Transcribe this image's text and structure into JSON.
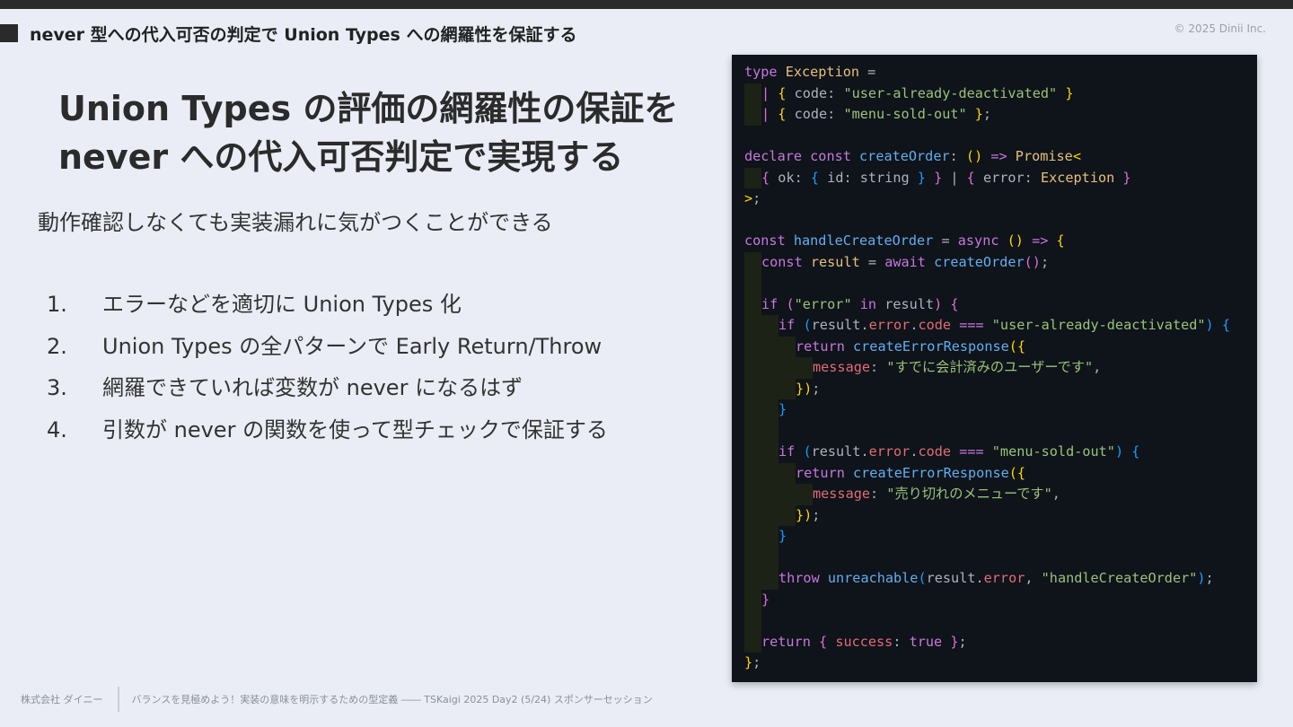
{
  "header": {
    "title": "never 型への代入可否の判定で Union Types への網羅性を保証する",
    "copyright": "© 2025 Dinii Inc."
  },
  "heading": {
    "line1": "Union Types の評価の網羅性の保証を",
    "line2": "never への代入可否判定で実現する"
  },
  "lead": "動作確認しなくても実装漏れに気がつくことができる",
  "steps": [
    {
      "num": "1.",
      "text": "エラーなどを適切に Union Types 化"
    },
    {
      "num": "2.",
      "text": "Union Types の全パターンで Early Return/Throw"
    },
    {
      "num": "3.",
      "text": "網羅できていれば変数が never になるはず"
    },
    {
      "num": "4.",
      "text": "引数が never の関数を使って型チェックで保証する"
    }
  ],
  "code": {
    "colors": {
      "keyword": "#c678dd",
      "type": "#e5c07b",
      "function": "#61afef",
      "string": "#98c379",
      "property": "#e06c75",
      "plain": "#abb2bf",
      "bracket1": "#ffd700",
      "bracket2": "#da70d6",
      "bracket3": "#179fff",
      "background": "#0f131a"
    },
    "lines": [
      {
        "indent": 0,
        "tokens": [
          [
            "kw",
            "type "
          ],
          [
            "type",
            "Exception "
          ],
          [
            "punc",
            "="
          ]
        ]
      },
      {
        "indent": 1,
        "tokens": [
          [
            "bl2",
            "| "
          ],
          [
            "bl",
            "{ "
          ],
          [
            "punc",
            "code: "
          ],
          [
            "str",
            "\"user-already-deactivated\""
          ],
          [
            "bl",
            " }"
          ]
        ]
      },
      {
        "indent": 1,
        "tokens": [
          [
            "bl2",
            "| "
          ],
          [
            "bl",
            "{ "
          ],
          [
            "punc",
            "code: "
          ],
          [
            "str",
            "\"menu-sold-out\""
          ],
          [
            "bl",
            " }"
          ],
          [
            "punc",
            ";"
          ]
        ]
      },
      {
        "indent": 0,
        "tokens": []
      },
      {
        "indent": 0,
        "tokens": [
          [
            "kw",
            "declare "
          ],
          [
            "kw",
            "const "
          ],
          [
            "fn",
            "createOrder"
          ],
          [
            "punc",
            ": "
          ],
          [
            "bl",
            "() "
          ],
          [
            "kw",
            "=> "
          ],
          [
            "type",
            "Promise"
          ],
          [
            "bl",
            "<"
          ]
        ]
      },
      {
        "indent": 1,
        "tokens": [
          [
            "bl2",
            "{ "
          ],
          [
            "punc",
            "ok: "
          ],
          [
            "bl3",
            "{ "
          ],
          [
            "punc",
            "id: string "
          ],
          [
            "bl3",
            "} "
          ],
          [
            "bl2",
            "} "
          ],
          [
            "punc",
            "| "
          ],
          [
            "bl2",
            "{ "
          ],
          [
            "punc",
            "error: "
          ],
          [
            "type",
            "Exception "
          ],
          [
            "bl2",
            "}"
          ]
        ]
      },
      {
        "indent": 0,
        "tokens": [
          [
            "bl",
            ">"
          ],
          [
            "punc",
            ";"
          ]
        ]
      },
      {
        "indent": 0,
        "tokens": []
      },
      {
        "indent": 0,
        "tokens": [
          [
            "kw",
            "const "
          ],
          [
            "fn",
            "handleCreateOrder "
          ],
          [
            "punc",
            "= "
          ],
          [
            "kw",
            "async "
          ],
          [
            "bl",
            "() "
          ],
          [
            "kw",
            "=> "
          ],
          [
            "bl",
            "{"
          ]
        ]
      },
      {
        "indent": 1,
        "tokens": [
          [
            "kw",
            "const "
          ],
          [
            "type",
            "result "
          ],
          [
            "punc",
            "= "
          ],
          [
            "kw",
            "await "
          ],
          [
            "fn",
            "createOrder"
          ],
          [
            "bl2",
            "()"
          ],
          [
            "punc",
            ";"
          ]
        ]
      },
      {
        "indent": 1,
        "tokens": []
      },
      {
        "indent": 1,
        "tokens": [
          [
            "kw",
            "if "
          ],
          [
            "bl2",
            "("
          ],
          [
            "str",
            "\"error\" "
          ],
          [
            "kw",
            "in "
          ],
          [
            "punc",
            "result"
          ],
          [
            "bl2",
            ") "
          ],
          [
            "bl2",
            "{"
          ]
        ]
      },
      {
        "indent": 2,
        "tokens": [
          [
            "kw",
            "if "
          ],
          [
            "bl3",
            "("
          ],
          [
            "punc",
            "result."
          ],
          [
            "prop",
            "error"
          ],
          [
            "punc",
            "."
          ],
          [
            "prop",
            "code "
          ],
          [
            "kw",
            "=== "
          ],
          [
            "str",
            "\"user-already-deactivated\""
          ],
          [
            "bl3",
            ") {"
          ]
        ]
      },
      {
        "indent": 3,
        "tokens": [
          [
            "kw",
            "return "
          ],
          [
            "fn",
            "createErrorResponse"
          ],
          [
            "bl",
            "({"
          ]
        ]
      },
      {
        "indent": 4,
        "tokens": [
          [
            "prop",
            "message"
          ],
          [
            "punc",
            ": "
          ],
          [
            "str",
            "\"すでに会計済みのユーザーです\""
          ],
          [
            "punc",
            ","
          ]
        ]
      },
      {
        "indent": 3,
        "tokens": [
          [
            "bl",
            "})"
          ],
          [
            "punc",
            ";"
          ]
        ]
      },
      {
        "indent": 2,
        "tokens": [
          [
            "bl3",
            "}"
          ]
        ]
      },
      {
        "indent": 2,
        "tokens": []
      },
      {
        "indent": 2,
        "tokens": [
          [
            "kw",
            "if "
          ],
          [
            "bl3",
            "("
          ],
          [
            "punc",
            "result."
          ],
          [
            "prop",
            "error"
          ],
          [
            "punc",
            "."
          ],
          [
            "prop",
            "code "
          ],
          [
            "kw",
            "=== "
          ],
          [
            "str",
            "\"menu-sold-out\""
          ],
          [
            "bl3",
            ") {"
          ]
        ]
      },
      {
        "indent": 3,
        "tokens": [
          [
            "kw",
            "return "
          ],
          [
            "fn",
            "createErrorResponse"
          ],
          [
            "bl",
            "({"
          ]
        ]
      },
      {
        "indent": 4,
        "tokens": [
          [
            "prop",
            "message"
          ],
          [
            "punc",
            ": "
          ],
          [
            "str",
            "\"売り切れのメニューです\""
          ],
          [
            "punc",
            ","
          ]
        ]
      },
      {
        "indent": 3,
        "tokens": [
          [
            "bl",
            "})"
          ],
          [
            "punc",
            ";"
          ]
        ]
      },
      {
        "indent": 2,
        "tokens": [
          [
            "bl3",
            "}"
          ]
        ]
      },
      {
        "indent": 2,
        "tokens": []
      },
      {
        "indent": 2,
        "tokens": [
          [
            "kw",
            "throw "
          ],
          [
            "fn",
            "unreachable"
          ],
          [
            "bl3",
            "("
          ],
          [
            "punc",
            "result."
          ],
          [
            "prop",
            "error"
          ],
          [
            "punc",
            ", "
          ],
          [
            "str",
            "\"handleCreateOrder\""
          ],
          [
            "bl3",
            ")"
          ],
          [
            "punc",
            ";"
          ]
        ]
      },
      {
        "indent": 1,
        "tokens": [
          [
            "bl2",
            "}"
          ]
        ]
      },
      {
        "indent": 1,
        "tokens": []
      },
      {
        "indent": 1,
        "tokens": [
          [
            "kw",
            "return "
          ],
          [
            "bl2",
            "{ "
          ],
          [
            "prop",
            "success"
          ],
          [
            "punc",
            ": "
          ],
          [
            "kw",
            "true "
          ],
          [
            "bl2",
            "}"
          ],
          [
            "punc",
            ";"
          ]
        ]
      },
      {
        "indent": 0,
        "tokens": [
          [
            "bl",
            "}"
          ],
          [
            "punc",
            ";"
          ]
        ]
      }
    ]
  },
  "footer": {
    "company": "株式会社 ダイニー",
    "session": "バランスを見極めよう！実装の意味を明示するための型定義 ―― TSKaigi 2025 Day2 (5/24) スポンサーセッション"
  }
}
